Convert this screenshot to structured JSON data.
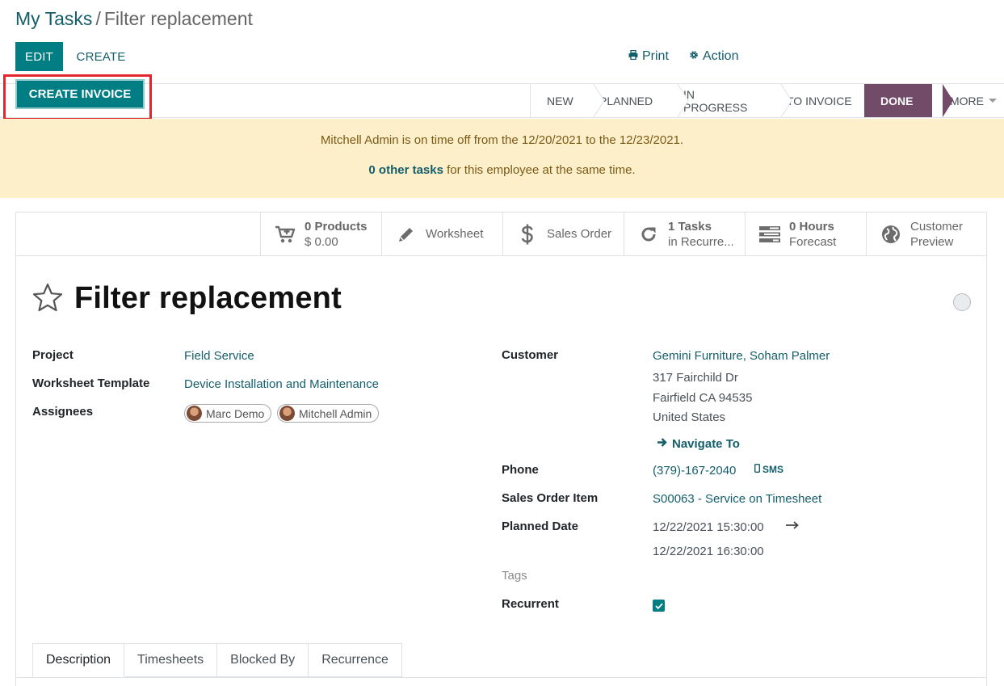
{
  "breadcrumb": {
    "parent": "My Tasks",
    "separator": "/",
    "current": "Filter replacement"
  },
  "toolbar": {
    "edit_label": "EDIT",
    "create_label": "CREATE",
    "print_label": "Print",
    "action_label": "Action"
  },
  "statusbar": {
    "create_invoice_label": "CREATE INVOICE",
    "stages": [
      "NEW",
      "PLANNED",
      "IN PROGRESS",
      "TO INVOICE",
      "DONE"
    ],
    "active_stage": "DONE",
    "more_label": "MORE"
  },
  "alert": {
    "line1": "Mitchell Admin is on time off from the 12/20/2021 to the 12/23/2021.",
    "line2_link": "0 other tasks",
    "line2_rest": " for this employee at the same time."
  },
  "smart_buttons": {
    "products": {
      "value": "0 Products",
      "sub": "$ 0.00",
      "icon": "cart-plus-icon"
    },
    "worksheet": {
      "label": "Worksheet",
      "icon": "pencil-icon"
    },
    "sales_order": {
      "label": "Sales Order",
      "icon": "dollar-icon"
    },
    "tasks": {
      "value": "1 Tasks",
      "sub": "in Recurre...",
      "icon": "refresh-icon"
    },
    "hours": {
      "value": "0  Hours",
      "sub": "Forecast",
      "icon": "tasks-icon"
    },
    "customer": {
      "value": "Customer",
      "sub": "Preview",
      "icon": "globe-icon"
    }
  },
  "task": {
    "title": "Filter replacement"
  },
  "fields_left": {
    "project_label": "Project",
    "project_value": "Field Service",
    "worksheet_label": "Worksheet Template",
    "worksheet_value": "Device Installation and Maintenance",
    "assignees_label": "Assignees",
    "assignees": [
      "Marc Demo",
      "Mitchell Admin"
    ]
  },
  "fields_right": {
    "customer_label": "Customer",
    "customer_name": "Gemini Furniture, Soham Palmer",
    "address_line1": "317 Fairchild Dr",
    "address_line2": "Fairfield CA 94535",
    "address_line3": "United States",
    "navigate_label": "Navigate To",
    "phone_label": "Phone",
    "phone_value": "(379)-167-2040",
    "sms_label": "SMS",
    "sale_item_label": "Sales Order Item",
    "sale_item_value": "S00063 - Service on Timesheet",
    "planned_label": "Planned Date",
    "planned_start": "12/22/2021 15:30:00",
    "planned_end": "12/22/2021 16:30:00",
    "tags_label": "Tags",
    "recurrent_label": "Recurrent",
    "recurrent_checked": true
  },
  "tabs": [
    "Description",
    "Timesheets",
    "Blocked By",
    "Recurrence"
  ],
  "colors": {
    "primary": "#017e84",
    "link": "#145e6b",
    "done_stage": "#714b67",
    "alert_bg": "#fdefc9",
    "highlight": "#e3262d"
  }
}
